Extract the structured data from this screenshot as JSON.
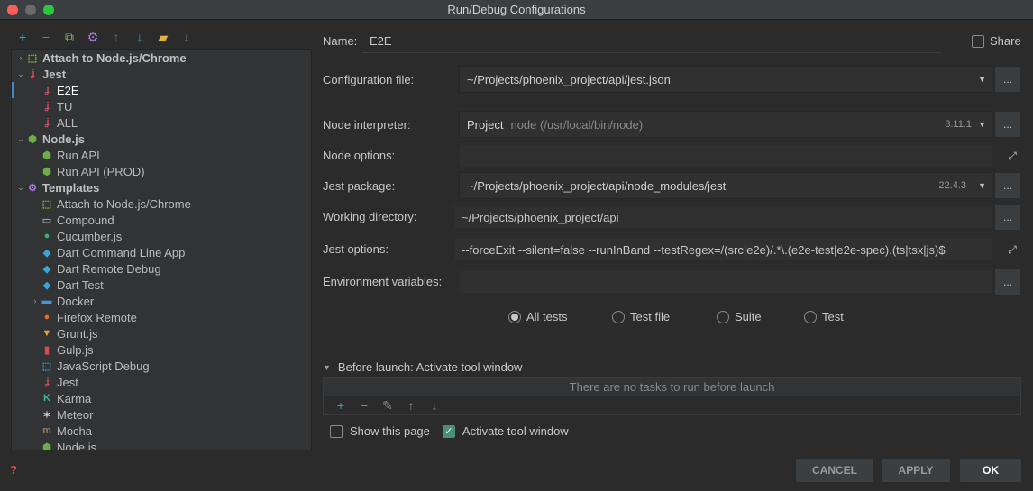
{
  "window": {
    "title": "Run/Debug Configurations"
  },
  "toolbar": {
    "items": [
      {
        "icon": "add-icon",
        "glyph": "+",
        "color": "#3ba5b6"
      },
      {
        "icon": "remove-icon",
        "glyph": "−",
        "color": "#e05555"
      },
      {
        "icon": "copy-icon",
        "glyph": "⧉",
        "color": "#7fbf5a"
      },
      {
        "icon": "settings-icon",
        "glyph": "⚙",
        "color": "#a77bd8"
      },
      {
        "icon": "move-up-icon",
        "glyph": "↑",
        "color": "#6a6a6a"
      },
      {
        "icon": "move-down-icon",
        "glyph": "↓",
        "color": "#3ba5b6"
      },
      {
        "icon": "folder-icon",
        "glyph": "▰",
        "color": "#e0b53a"
      },
      {
        "icon": "sort-icon",
        "glyph": "↓",
        "color": "#8a8a8a"
      }
    ]
  },
  "tree": {
    "items": [
      {
        "label": "Attach to Node.js/Chrome",
        "bold": true,
        "indent": 0,
        "arrow": "›",
        "icon": "attach-icon",
        "glyph": "⬚",
        "color": "#8bc34a"
      },
      {
        "label": "Jest",
        "bold": true,
        "indent": 0,
        "arrow": "⌄",
        "icon": "jest-icon",
        "glyph": "ʝ",
        "color": "#c94a5d"
      },
      {
        "label": "E2E",
        "bold": false,
        "indent": 1,
        "arrow": "",
        "icon": "jest-icon",
        "glyph": "ʝ",
        "color": "#c94a5d",
        "selected": true
      },
      {
        "label": "TU",
        "bold": false,
        "indent": 1,
        "arrow": "",
        "icon": "jest-icon",
        "glyph": "ʝ",
        "color": "#c94a5d"
      },
      {
        "label": "ALL",
        "bold": false,
        "indent": 1,
        "arrow": "",
        "icon": "jest-icon",
        "glyph": "ʝ",
        "color": "#c94a5d"
      },
      {
        "label": "Node.js",
        "bold": true,
        "indent": 0,
        "arrow": "⌄",
        "icon": "nodejs-icon",
        "glyph": "⬢",
        "color": "#6cad4b"
      },
      {
        "label": "Run API",
        "bold": false,
        "indent": 1,
        "arrow": "",
        "icon": "nodejs-icon",
        "glyph": "⬢",
        "color": "#6cad4b"
      },
      {
        "label": "Run API (PROD)",
        "bold": false,
        "indent": 1,
        "arrow": "",
        "icon": "nodejs-icon",
        "glyph": "⬢",
        "color": "#6cad4b"
      },
      {
        "label": "Templates",
        "bold": true,
        "indent": 0,
        "arrow": "⌄",
        "icon": "templates-icon",
        "glyph": "⚙",
        "color": "#a77bd8"
      },
      {
        "label": "Attach to Node.js/Chrome",
        "bold": false,
        "indent": 1,
        "arrow": "",
        "icon": "attach-icon",
        "glyph": "⬚",
        "color": "#8bc34a"
      },
      {
        "label": "Compound",
        "bold": false,
        "indent": 1,
        "arrow": "",
        "icon": "compound-icon",
        "glyph": "▭",
        "color": "#9a9a9a"
      },
      {
        "label": "Cucumber.js",
        "bold": false,
        "indent": 1,
        "arrow": "",
        "icon": "cucumber-icon",
        "glyph": "●",
        "color": "#2fb36b"
      },
      {
        "label": "Dart Command Line App",
        "bold": false,
        "indent": 1,
        "arrow": "",
        "icon": "dart-icon",
        "glyph": "◆",
        "color": "#3ba5d8"
      },
      {
        "label": "Dart Remote Debug",
        "bold": false,
        "indent": 1,
        "arrow": "",
        "icon": "dart-icon",
        "glyph": "◆",
        "color": "#3ba5d8"
      },
      {
        "label": "Dart Test",
        "bold": false,
        "indent": 1,
        "arrow": "",
        "icon": "dart-icon",
        "glyph": "◆",
        "color": "#3ba5d8"
      },
      {
        "label": "Docker",
        "bold": false,
        "indent": 1,
        "arrow": "›",
        "icon": "docker-icon",
        "glyph": "▬",
        "color": "#3b9ad8"
      },
      {
        "label": "Firefox Remote",
        "bold": false,
        "indent": 1,
        "arrow": "",
        "icon": "firefox-icon",
        "glyph": "●",
        "color": "#e66a2c"
      },
      {
        "label": "Grunt.js",
        "bold": false,
        "indent": 1,
        "arrow": "",
        "icon": "grunt-icon",
        "glyph": "▼",
        "color": "#e0a43a"
      },
      {
        "label": "Gulp.js",
        "bold": false,
        "indent": 1,
        "arrow": "",
        "icon": "gulp-icon",
        "glyph": "▮",
        "color": "#d94a4a"
      },
      {
        "label": "JavaScript Debug",
        "bold": false,
        "indent": 1,
        "arrow": "",
        "icon": "javascript-debug-icon",
        "glyph": "⬚",
        "color": "#3ba5d8"
      },
      {
        "label": "Jest",
        "bold": false,
        "indent": 1,
        "arrow": "",
        "icon": "jest-icon",
        "glyph": "ʝ",
        "color": "#c94a5d"
      },
      {
        "label": "Karma",
        "bold": false,
        "indent": 1,
        "arrow": "",
        "icon": "karma-icon",
        "glyph": "K",
        "color": "#3bb5a5"
      },
      {
        "label": "Meteor",
        "bold": false,
        "indent": 1,
        "arrow": "",
        "icon": "meteor-icon",
        "glyph": "✶",
        "color": "#c8c8c8"
      },
      {
        "label": "Mocha",
        "bold": false,
        "indent": 1,
        "arrow": "",
        "icon": "mocha-icon",
        "glyph": "m",
        "color": "#a0785a"
      },
      {
        "label": "Node.js",
        "bold": false,
        "indent": 1,
        "arrow": "",
        "icon": "nodejs-icon",
        "glyph": "⬢",
        "color": "#6cad4b"
      }
    ]
  },
  "form": {
    "name_label": "Name:",
    "name_value": "E2E",
    "share_label": "Share",
    "config_file_label": "Configuration file:",
    "config_file_value": "~/Projects/phoenix_project/api/jest.json",
    "node_interpreter_label": "Node interpreter:",
    "node_interpreter_project": "Project",
    "node_interpreter_path": "node (/usr/local/bin/node)",
    "node_interpreter_version": "8.11.1",
    "node_options_label": "Node options:",
    "node_options_value": "",
    "jest_package_label": "Jest package:",
    "jest_package_value": "~/Projects/phoenix_project/api/node_modules/jest",
    "jest_package_version": "22.4.3",
    "working_dir_label": "Working directory:",
    "working_dir_value": "~/Projects/phoenix_project/api",
    "jest_options_label": "Jest options:",
    "jest_options_value": "--forceExit --silent=false --runInBand --testRegex=/(src|e2e)/.*\\.(e2e-test|e2e-spec).(ts|tsx|js)$",
    "env_vars_label": "Environment variables:",
    "env_vars_value": "",
    "dots": "...",
    "expand": "⤢"
  },
  "scope": {
    "options": [
      {
        "label": "All tests",
        "checked": true
      },
      {
        "label": "Test file",
        "checked": false
      },
      {
        "label": "Suite",
        "checked": false
      },
      {
        "label": "Test",
        "checked": false
      }
    ]
  },
  "before_launch": {
    "title": "Before launch: Activate tool window",
    "empty_text": "There are no tasks to run before launch",
    "show_page_label": "Show this page",
    "show_page_checked": false,
    "activate_label": "Activate tool window",
    "activate_checked": true
  },
  "buttons": {
    "cancel": "CANCEL",
    "apply": "APPLY",
    "ok": "OK"
  }
}
